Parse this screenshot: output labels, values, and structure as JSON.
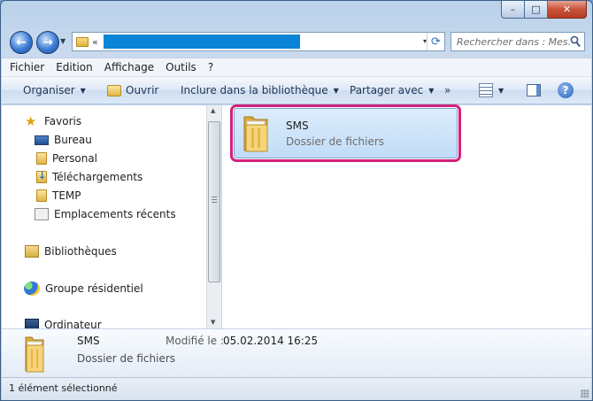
{
  "window": {
    "caption_buttons": {
      "minimize_glyph": "–",
      "maximize_glyph": "□",
      "close_glyph": "✕"
    }
  },
  "address": {
    "chevron": "«",
    "selected_text": "",
    "refresh_glyph": "⟳",
    "dropdown_glyph": "▾"
  },
  "search": {
    "placeholder": "Rechercher dans : Mes..."
  },
  "menu": [
    "Fichier",
    "Edition",
    "Affichage",
    "Outils",
    "?"
  ],
  "commands": {
    "organiser": "Organiser",
    "ouvrir": "Ouvrir",
    "inclure": "Inclure dans la bibliothèque",
    "partager": "Partager avec",
    "more": "»",
    "help": "?"
  },
  "nav": {
    "favoris": "Favoris",
    "items": [
      "Bureau",
      "Personal",
      "Téléchargements",
      "TEMP",
      "Emplacements récents"
    ],
    "bibliotheques": "Bibliothèques",
    "groupe": "Groupe résidentiel",
    "ordinateur": "Ordinateur"
  },
  "content": {
    "folder_name": "SMS",
    "folder_type": "Dossier de fichiers"
  },
  "details": {
    "name": "SMS",
    "type": "Dossier de fichiers",
    "modified_label": "Modifié le :",
    "modified_value": "05.02.2014 16:25"
  },
  "status": {
    "text": "1 élément sélectionné"
  },
  "colors": {
    "selection_blue": "#0a84d6",
    "highlight_pink": "#d3217a",
    "tile_bg": "#c1dcf7"
  }
}
